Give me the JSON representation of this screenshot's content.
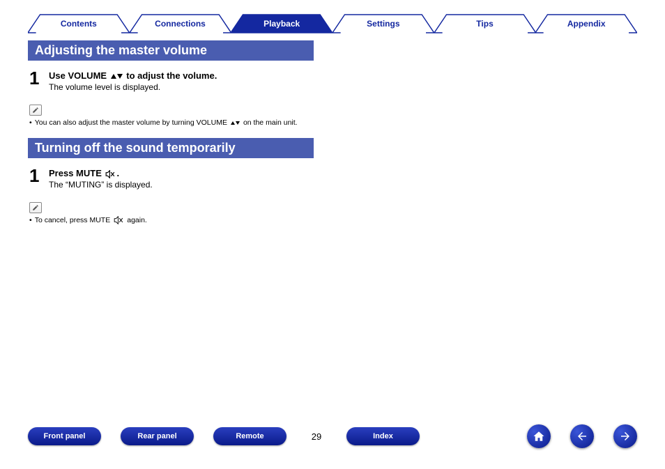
{
  "tabs": [
    {
      "label": "Contents",
      "active": false
    },
    {
      "label": "Connections",
      "active": false
    },
    {
      "label": "Playback",
      "active": true
    },
    {
      "label": "Settings",
      "active": false
    },
    {
      "label": "Tips",
      "active": false
    },
    {
      "label": "Appendix",
      "active": false
    }
  ],
  "section1": {
    "heading": "Adjusting the master volume",
    "step_num": "1",
    "step_title_pre": "Use VOLUME ",
    "step_title_post": " to adjust the volume.",
    "step_desc": "The volume level is displayed.",
    "note_pre": "You can also adjust the master volume by turning VOLUME ",
    "note_post": " on the main unit."
  },
  "section2": {
    "heading": "Turning off the sound temporarily",
    "step_num": "1",
    "step_title_pre": "Press MUTE ",
    "step_title_post": ".",
    "step_desc": "The “MUTING” is displayed.",
    "note_pre": "To cancel, press MUTE ",
    "note_post": " again."
  },
  "footer": {
    "buttons": [
      "Front panel",
      "Rear panel",
      "Remote",
      "Index"
    ],
    "page": "29"
  }
}
